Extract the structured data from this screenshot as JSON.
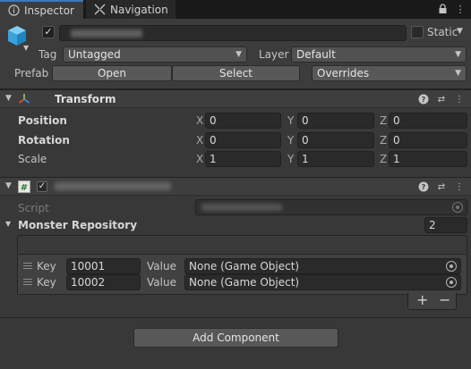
{
  "tabs": [
    {
      "label": "Inspector",
      "icon": "info-icon"
    },
    {
      "label": "Navigation",
      "icon": "navigation-icon"
    }
  ],
  "header": {
    "active_checked": true,
    "static_label": "Static",
    "tag_label": "Tag",
    "tag_value": "Untagged",
    "layer_label": "Layer",
    "layer_value": "Default",
    "prefab_label": "Prefab",
    "open_label": "Open",
    "select_label": "Select",
    "overrides_label": "Overrides"
  },
  "transform": {
    "title": "Transform",
    "rows": [
      {
        "label": "Position",
        "x": "0",
        "y": "0",
        "z": "0"
      },
      {
        "label": "Rotation",
        "x": "0",
        "y": "0",
        "z": "0"
      },
      {
        "label": "Scale",
        "x": "1",
        "y": "1",
        "z": "1"
      }
    ],
    "axis": {
      "x": "X",
      "y": "Y",
      "z": "Z"
    }
  },
  "script_component": {
    "script_label": "Script",
    "list_label": "Monster Repository",
    "list_size": "2",
    "items": [
      {
        "key_label": "Key",
        "key_value": "10001",
        "value_label": "Value",
        "value": "None (Game Object)"
      },
      {
        "key_label": "Key",
        "key_value": "10002",
        "value_label": "Value",
        "value": "None (Game Object)"
      }
    ],
    "add_symbol": "+",
    "remove_symbol": "−"
  },
  "add_component_label": "Add Component",
  "colors": {
    "background": "#383838",
    "accent_tab": "#3a79bb",
    "field_bg": "#2a2a2a"
  }
}
